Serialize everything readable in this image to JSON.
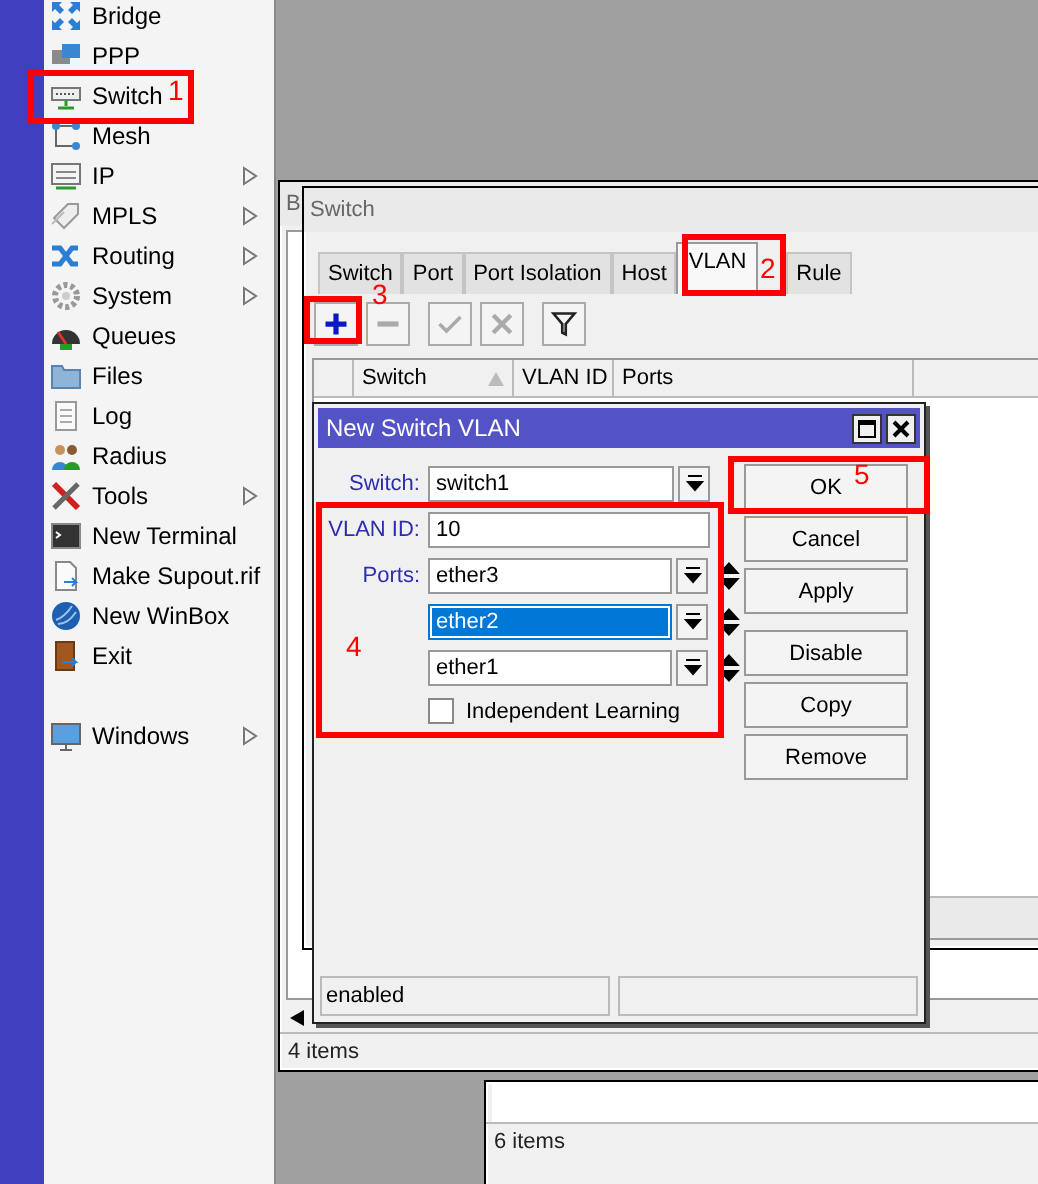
{
  "sidebar": {
    "items": [
      {
        "label": "Bridge",
        "submenu": false
      },
      {
        "label": "PPP",
        "submenu": false
      },
      {
        "label": "Switch",
        "submenu": false
      },
      {
        "label": "Mesh",
        "submenu": false
      },
      {
        "label": "IP",
        "submenu": true
      },
      {
        "label": "MPLS",
        "submenu": true
      },
      {
        "label": "Routing",
        "submenu": true
      },
      {
        "label": "System",
        "submenu": true
      },
      {
        "label": "Queues",
        "submenu": false
      },
      {
        "label": "Files",
        "submenu": false
      },
      {
        "label": "Log",
        "submenu": false
      },
      {
        "label": "Radius",
        "submenu": false
      },
      {
        "label": "Tools",
        "submenu": true
      },
      {
        "label": "New Terminal",
        "submenu": false
      },
      {
        "label": "Make Supout.rif",
        "submenu": false
      },
      {
        "label": "New WinBox",
        "submenu": false
      },
      {
        "label": "Exit",
        "submenu": false
      }
    ],
    "footer_items": [
      {
        "label": "Windows",
        "submenu": true
      }
    ]
  },
  "background_window": {
    "title": "B",
    "status": "4 items"
  },
  "switch_window": {
    "title": "Switch",
    "tabs": [
      {
        "label": "Switch",
        "selected": false
      },
      {
        "label": "Port",
        "selected": false
      },
      {
        "label": "Port Isolation",
        "selected": false
      },
      {
        "label": "Host",
        "selected": false
      },
      {
        "label": "VLAN",
        "selected": true
      },
      {
        "label": "Rule",
        "selected": false
      }
    ],
    "toolbar": [
      {
        "kind": "add",
        "disabled": false
      },
      {
        "kind": "remove",
        "disabled": true
      },
      {
        "kind": "enable",
        "disabled": true
      },
      {
        "kind": "disable",
        "disabled": true
      },
      {
        "kind": "filter",
        "disabled": false
      }
    ],
    "table": {
      "columns": [
        {
          "label": "Switch",
          "sorted": true
        },
        {
          "label": "VLAN ID",
          "sorted": false
        },
        {
          "label": "Ports",
          "sorted": false
        }
      ]
    }
  },
  "dialog": {
    "title": "New Switch VLAN",
    "switch": {
      "label": "Switch:",
      "value": "switch1"
    },
    "vlan_id": {
      "label": "VLAN ID:",
      "value": "10"
    },
    "ports": {
      "label": "Ports:",
      "items": [
        {
          "value": "ether3",
          "selected": false
        },
        {
          "value": "ether2",
          "selected": true
        },
        {
          "value": "ether1",
          "selected": false
        }
      ]
    },
    "independent_learning": {
      "label": "Independent Learning",
      "checked": false
    },
    "buttons": [
      "OK",
      "Cancel",
      "Apply",
      "Disable",
      "Copy",
      "Remove"
    ],
    "status": "enabled"
  },
  "lower_window": {
    "status": "6 items"
  },
  "annotations": [
    {
      "text": "1"
    },
    {
      "text": "2"
    },
    {
      "text": "3"
    },
    {
      "text": "4"
    },
    {
      "text": "5"
    }
  ]
}
